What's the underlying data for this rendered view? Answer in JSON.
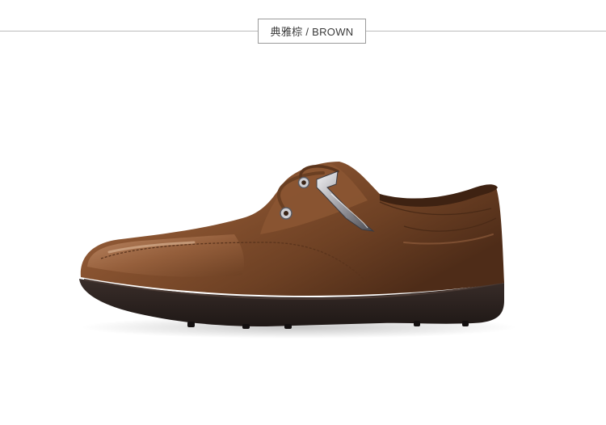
{
  "header": {
    "color_label": "典雅棕 / BROWN"
  },
  "product_photo": {
    "subject": "brown-leather-lace-up-shoe-icon",
    "colors": {
      "upper": "#7a4a2a",
      "upper_highlight": "#b07a52",
      "sole": "#2b2220",
      "hardware": "#c9c9cc",
      "background": "#ffffff"
    }
  }
}
